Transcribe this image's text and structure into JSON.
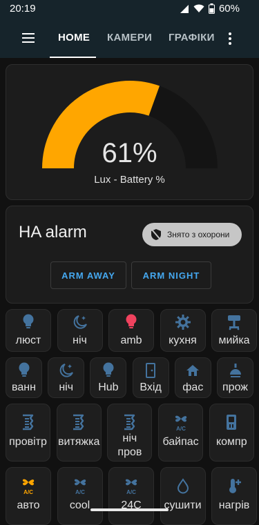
{
  "status": {
    "time": "20:19",
    "battery": "60%"
  },
  "tabs": [
    {
      "label": "HOME",
      "active": true
    },
    {
      "label": "КАМЕРИ",
      "active": false
    },
    {
      "label": "ГРАФІКИ",
      "active": false
    }
  ],
  "gauge": {
    "value": 61,
    "value_text": "61%",
    "name": "Lux - Battery %",
    "min": 0,
    "max": 100,
    "color": "#ffa600",
    "track_color": "#141414"
  },
  "alarm": {
    "title": "HA alarm",
    "state": "Знято з охорони",
    "buttons": [
      "ARM AWAY",
      "ARM NIGHT"
    ]
  },
  "rows": [
    [
      {
        "label": "люст",
        "icon": "bulb-icon",
        "color": "#44739e"
      },
      {
        "label": "ніч",
        "icon": "moon-stars-icon",
        "color": "#44739e"
      },
      {
        "label": "amb",
        "icon": "bulb-icon",
        "color": "#f0425e"
      },
      {
        "label": "кухня",
        "icon": "brightness-icon",
        "color": "#44739e"
      },
      {
        "label": "мийка",
        "icon": "desk-lamp-icon",
        "color": "#44739e"
      }
    ],
    [
      {
        "label": "ванн",
        "icon": "bulb-icon",
        "color": "#44739e"
      },
      {
        "label": "ніч",
        "icon": "moon-stars-icon",
        "color": "#44739e"
      },
      {
        "label": "Hub",
        "icon": "bulb-icon",
        "color": "#44739e"
      },
      {
        "label": "Вхід",
        "icon": "door-icon",
        "color": "#44739e"
      },
      {
        "label": "фас",
        "icon": "home-icon",
        "color": "#44739e"
      },
      {
        "label": "прож",
        "icon": "spotlight-icon",
        "color": "#44739e"
      }
    ],
    [
      {
        "label": "провітр",
        "icon": "air-filter-icon",
        "color": "#44739e"
      },
      {
        "label": "витяжка",
        "icon": "air-filter-icon",
        "color": "#44739e"
      },
      {
        "label": "ніч пров",
        "icon": "air-filter-icon",
        "color": "#44739e"
      },
      {
        "label": "байпас",
        "icon": "fan-ac-icon",
        "color": "#44739e"
      },
      {
        "label": "компр",
        "icon": "compressor-icon",
        "color": "#44739e"
      }
    ],
    [
      {
        "label": "авто",
        "icon": "fan-ac-icon",
        "color": "#ffa600"
      },
      {
        "label": "cool",
        "icon": "fan-ac-icon",
        "color": "#44739e"
      },
      {
        "label": "24C",
        "icon": "fan-ac-icon",
        "color": "#44739e"
      },
      {
        "label": "сушити",
        "icon": "water-icon",
        "color": "#44739e"
      },
      {
        "label": "нагрів",
        "icon": "thermometer-plus-icon",
        "color": "#44739e"
      }
    ]
  ]
}
